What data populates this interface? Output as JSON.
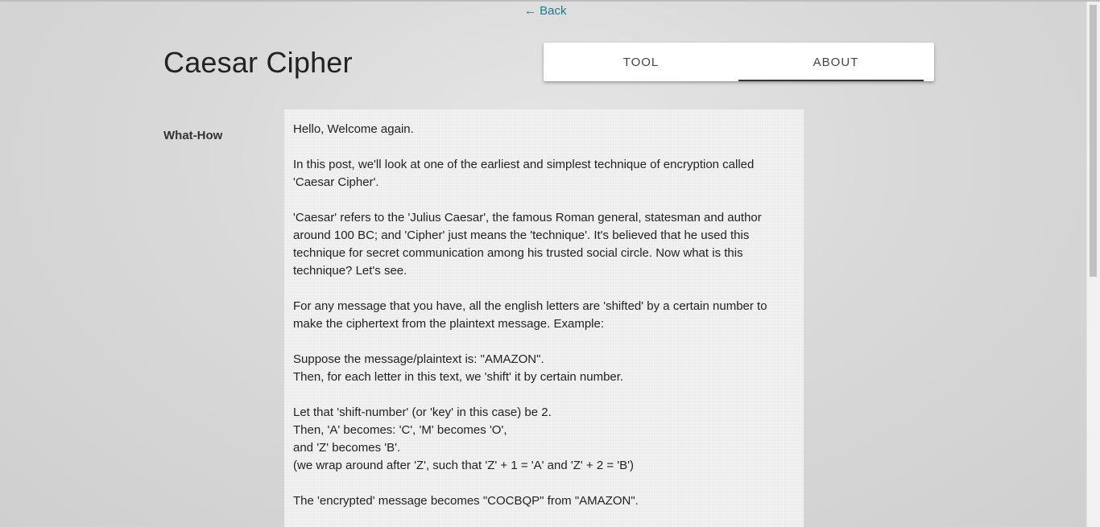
{
  "nav": {
    "back_label": "← Back"
  },
  "header": {
    "title": "Caesar Cipher"
  },
  "tabs": [
    {
      "label": "TOOL",
      "active": false
    },
    {
      "label": "ABOUT",
      "active": true
    }
  ],
  "content": {
    "section_label": "What-How",
    "paragraphs": [
      "Hello, Welcome again.",
      "In this post, we'll look at one of the earliest and simplest technique of encryption called\n'Caesar Cipher'.",
      "'Caesar' refers to the 'Julius Caesar', the famous Roman general, statesman and author\naround 100 BC; and 'Cipher' just means the 'technique'. It's believed that he used this\ntechnique for secret communication among his trusted social circle. Now what is this\ntechnique? Let's see.",
      "For any message that you have, all the english letters are 'shifted' by a certain number to\nmake the ciphertext from the plaintext message. Example:",
      "Suppose the message/plaintext is: \"AMAZON\".\nThen, for each letter in this text, we 'shift' it by certain number.",
      "Let that 'shift-number' (or 'key' in this case) be 2.\nThen, 'A' becomes: 'C', 'M' becomes 'O',\nand 'Z' becomes 'B'.\n(we wrap around after 'Z', such that 'Z' + 1 = 'A' and 'Z' + 2 = 'B')",
      "The 'encrypted' message becomes \"COCBQP\" from \"AMAZON\"."
    ]
  },
  "colors": {
    "link": "#1b7d8c",
    "tab_indicator": "#333333",
    "paper": "#efefef"
  }
}
